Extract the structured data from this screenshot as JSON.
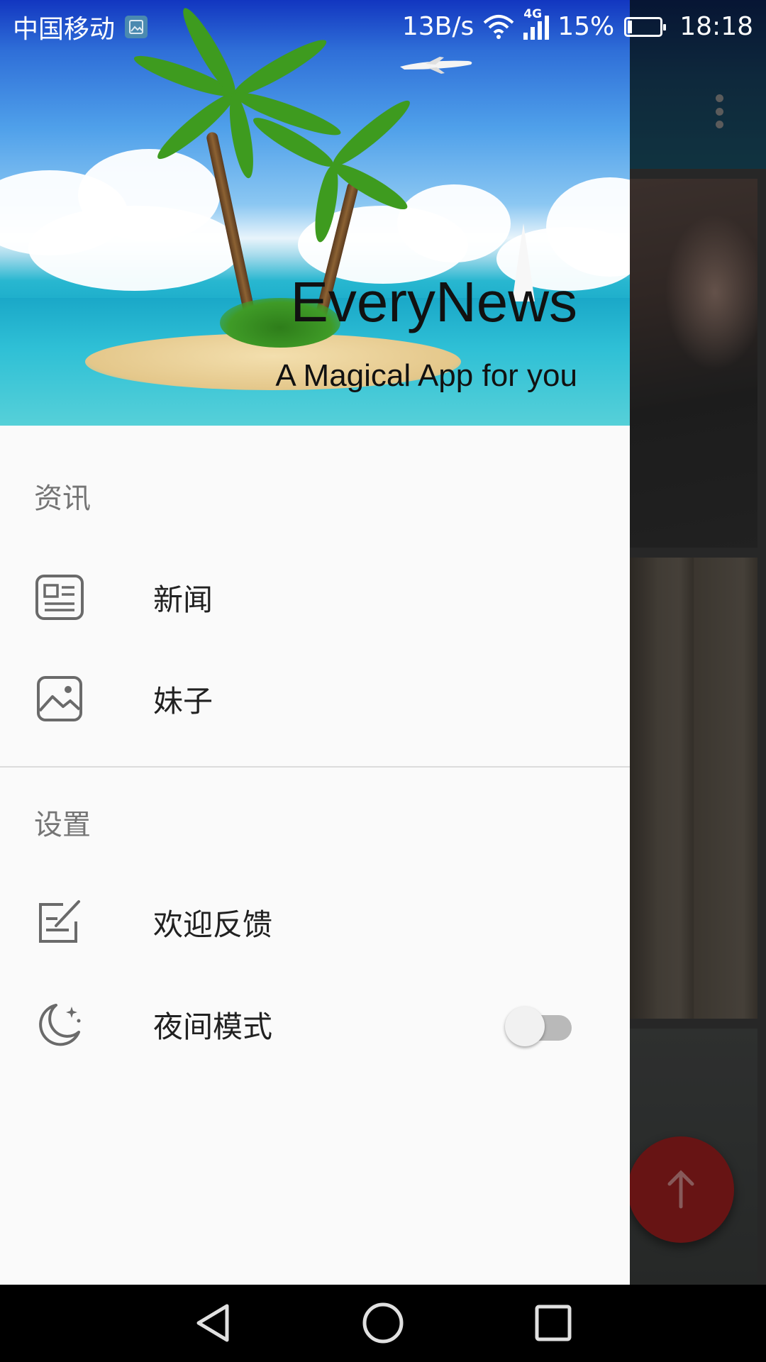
{
  "status_bar": {
    "carrier": "中国移动",
    "net_speed": "13B/s",
    "network_type": "4G",
    "battery": "15%",
    "time": "18:18",
    "icons": [
      "gallery-notification-icon",
      "wifi-icon",
      "signal-icon",
      "battery-icon"
    ]
  },
  "header": {
    "app_title": "EveryNews",
    "subtitle": "A Magical App for you"
  },
  "drawer": {
    "sections": [
      {
        "title": "资讯",
        "items": [
          {
            "label": "新闻",
            "icon": "news-icon"
          },
          {
            "label": "妹子",
            "icon": "image-icon"
          }
        ]
      },
      {
        "title": "设置",
        "items": [
          {
            "label": "欢迎反馈",
            "icon": "feedback-edit-icon"
          },
          {
            "label": "夜间模式",
            "icon": "night-moon-icon",
            "toggle": {
              "state": "off"
            }
          }
        ]
      }
    ]
  },
  "background_app": {
    "fab_icon": "arrow-up-icon",
    "fab_color": "#9e2020",
    "toolbar_menu_icon": "more-vert-icon"
  },
  "nav_bar": {
    "buttons": [
      "back-icon",
      "home-icon",
      "recent-apps-icon"
    ]
  }
}
